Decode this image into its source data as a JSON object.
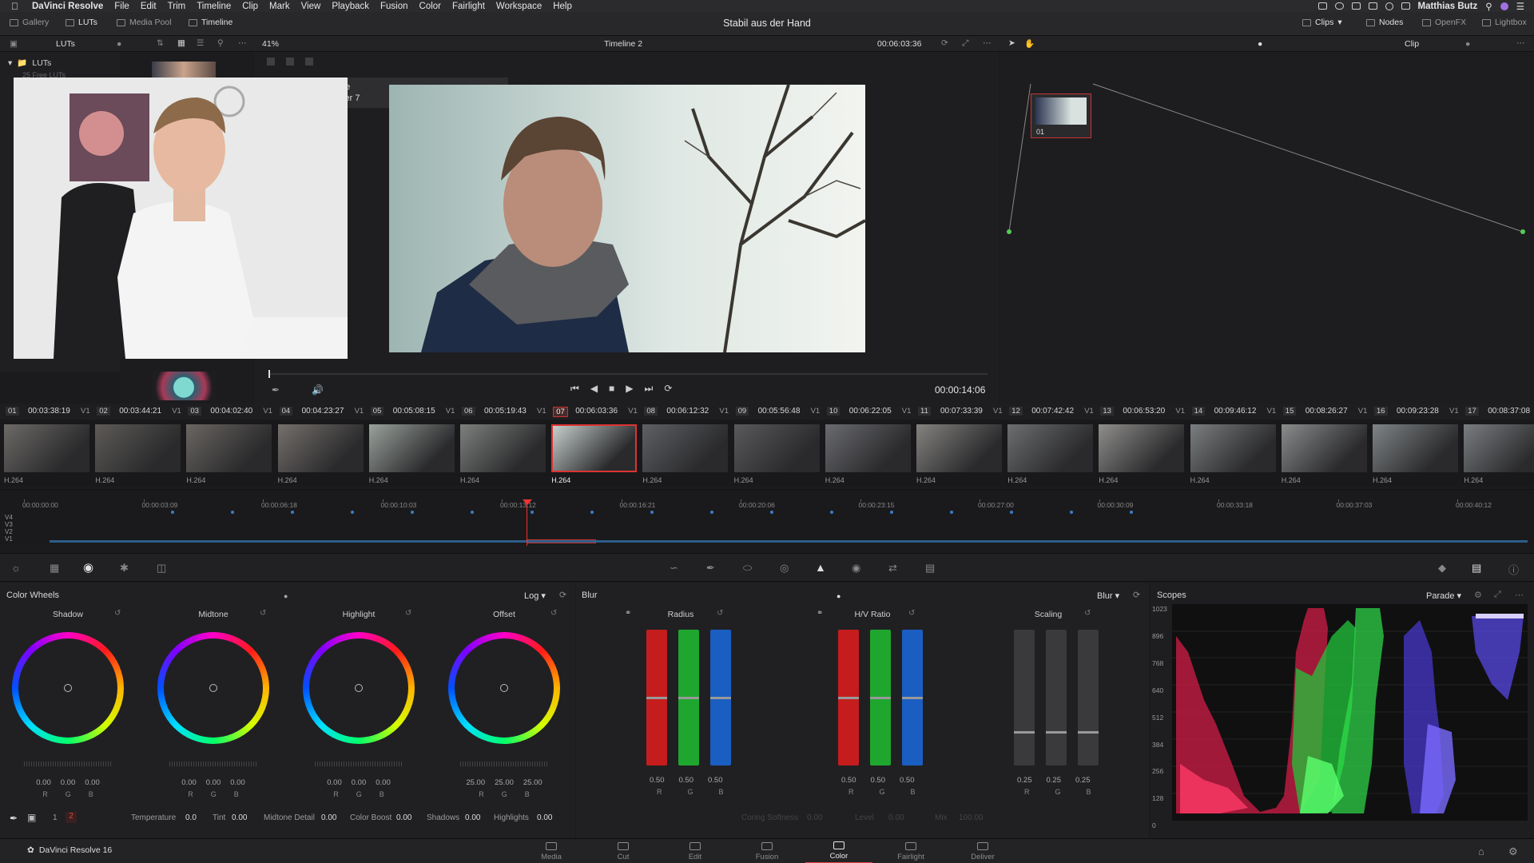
{
  "menubar": {
    "app": "DaVinci Resolve",
    "items": [
      "File",
      "Edit",
      "Trim",
      "Timeline",
      "Clip",
      "Mark",
      "View",
      "Playback",
      "Fusion",
      "Color",
      "Fairlight",
      "Workspace",
      "Help"
    ],
    "user": "Matthias Butz"
  },
  "toolbar": {
    "gallery": "Gallery",
    "luts": "LUTs",
    "media_pool": "Media Pool",
    "timeline": "Timeline",
    "project_title": "Stabil aus der Hand",
    "clips": "Clips",
    "nodes": "Nodes",
    "openfx": "OpenFX",
    "lightbox": "Lightbox"
  },
  "subbar": {
    "luts_label": "LUTs",
    "zoom": "41%",
    "timeline_name": "Timeline 2",
    "timecode": "00:06:03:36",
    "clip_mode": "Clip"
  },
  "lut_tree": {
    "root": "LUTs",
    "sub": "25 Free LUTs"
  },
  "viewer": {
    "overlay_line1": "ne",
    "overlay_line2": "ker 7",
    "duration": "00:00:14:06"
  },
  "node": {
    "label": "01"
  },
  "clips": [
    {
      "num": "01",
      "tc": "00:03:38:19",
      "track": "V1",
      "codec": "H.264"
    },
    {
      "num": "02",
      "tc": "00:03:44:21",
      "track": "V1",
      "codec": "H.264"
    },
    {
      "num": "03",
      "tc": "00:04:02:40",
      "track": "V1",
      "codec": "H.264"
    },
    {
      "num": "04",
      "tc": "00:04:23:27",
      "track": "V1",
      "codec": "H.264"
    },
    {
      "num": "05",
      "tc": "00:05:08:15",
      "track": "V1",
      "codec": "H.264"
    },
    {
      "num": "06",
      "tc": "00:05:19:43",
      "track": "V1",
      "codec": "H.264"
    },
    {
      "num": "07",
      "tc": "00:06:03:36",
      "track": "V1",
      "codec": "H.264"
    },
    {
      "num": "08",
      "tc": "00:06:12:32",
      "track": "V1",
      "codec": "H.264"
    },
    {
      "num": "09",
      "tc": "00:05:56:48",
      "track": "V1",
      "codec": "H.264"
    },
    {
      "num": "10",
      "tc": "00:06:22:05",
      "track": "V1",
      "codec": "H.264"
    },
    {
      "num": "11",
      "tc": "00:07:33:39",
      "track": "V1",
      "codec": "H.264"
    },
    {
      "num": "12",
      "tc": "00:07:42:42",
      "track": "V1",
      "codec": "H.264"
    },
    {
      "num": "13",
      "tc": "00:06:53:20",
      "track": "V1",
      "codec": "H.264"
    },
    {
      "num": "14",
      "tc": "00:09:46:12",
      "track": "V1",
      "codec": "H.264"
    },
    {
      "num": "15",
      "tc": "00:08:26:27",
      "track": "V1",
      "codec": "H.264"
    },
    {
      "num": "16",
      "tc": "00:09:23:28",
      "track": "V1",
      "codec": "H.264"
    },
    {
      "num": "17",
      "tc": "00:08:37:08",
      "track": "V1",
      "codec": "H.264"
    }
  ],
  "selected_clip": "07",
  "mini_timeline": {
    "ticks": [
      "00:00:00:00",
      "00:00:03:09",
      "00:00:06:18",
      "00:00:10:03",
      "00:00:13:12",
      "00:00:16:21",
      "00:00:20:06",
      "00:00:23:15",
      "00:00:27:00",
      "00:00:30:09",
      "00:00:33:18",
      "00:00:37:03",
      "00:00:40:12"
    ],
    "tracks": [
      "V4",
      "V3",
      "V2",
      "V1"
    ]
  },
  "color_wheels": {
    "title": "Color Wheels",
    "mode": "Log",
    "wheels": [
      {
        "name": "Shadow",
        "values": [
          "0.00",
          "0.00",
          "0.00"
        ]
      },
      {
        "name": "Midtone",
        "values": [
          "0.00",
          "0.00",
          "0.00"
        ]
      },
      {
        "name": "Highlight",
        "values": [
          "0.00",
          "0.00",
          "0.00"
        ]
      },
      {
        "name": "Offset",
        "values": [
          "25.00",
          "25.00",
          "25.00"
        ]
      }
    ],
    "rgb": [
      "R",
      "G",
      "B"
    ]
  },
  "blur": {
    "title": "Blur",
    "mode": "Blur",
    "groups": [
      {
        "name": "Radius",
        "values": [
          "0.50",
          "0.50",
          "0.50"
        ],
        "level": 0.5
      },
      {
        "name": "H/V Ratio",
        "values": [
          "0.50",
          "0.50",
          "0.50"
        ],
        "level": 0.5
      },
      {
        "name": "Scaling",
        "values": [
          "0.25",
          "0.25",
          "0.25"
        ],
        "level": 0.25
      }
    ]
  },
  "scopes": {
    "title": "Scopes",
    "mode": "Parade",
    "axis": [
      "1023",
      "896",
      "768",
      "640",
      "512",
      "384",
      "256",
      "128",
      "0"
    ]
  },
  "stats": {
    "page_a": "1",
    "page_b": "2",
    "temperature_label": "Temperature",
    "temperature": "0.0",
    "tint_label": "Tint",
    "tint": "0.00",
    "midtone_label": "Midtone Detail",
    "midtone": "0.00",
    "boost_label": "Color Boost",
    "boost": "0.00",
    "shadows_label": "Shadows",
    "shadows": "0.00",
    "highlights_label": "Highlights",
    "highlights": "0.00",
    "curve_label": "Coring Softness",
    "curve": "0.00",
    "level_label": "Level",
    "level": "0.00",
    "mix_label": "Mix",
    "mix": "100.00"
  },
  "footer": {
    "app": "DaVinci Resolve 16"
  },
  "pages": [
    "Media",
    "Cut",
    "Edit",
    "Fusion",
    "Color",
    "Fairlight",
    "Deliver"
  ],
  "active_page": "Color"
}
